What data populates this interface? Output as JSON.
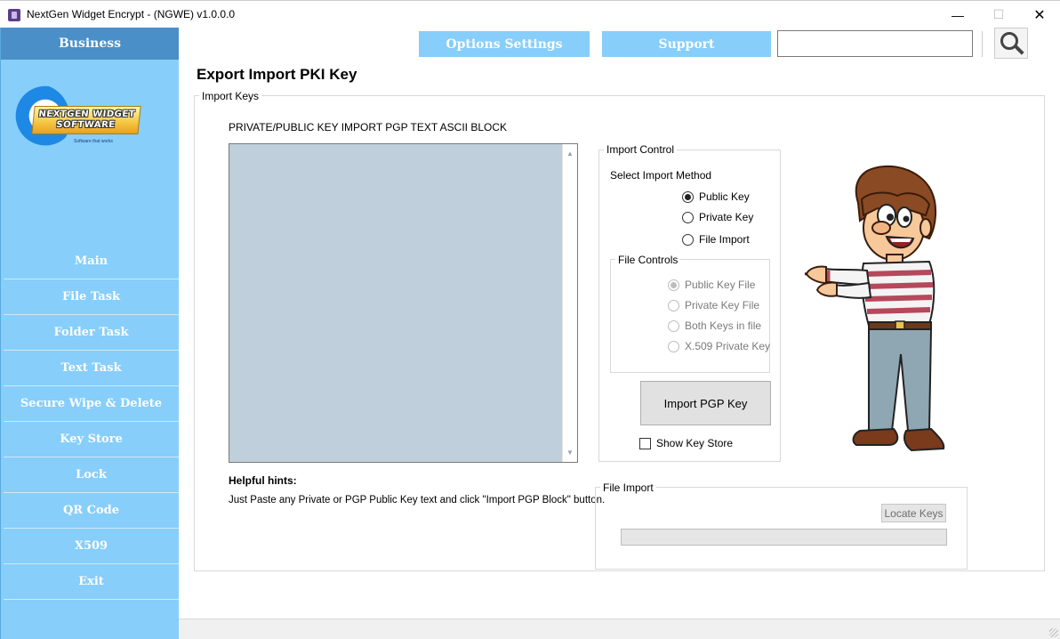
{
  "window": {
    "title": "NextGen Widget Encrypt - (NGWE) v1.0.0.0",
    "minimize": "—",
    "maximize": "☐",
    "close": "✕"
  },
  "sidebar": {
    "business": "Business",
    "logo": {
      "line1": "NEXTGEN WIDGET",
      "line2": "SOFTWARE",
      "tagline": "Software that works"
    },
    "items": [
      {
        "label": "Main"
      },
      {
        "label": "File Task"
      },
      {
        "label": "Folder Task"
      },
      {
        "label": "Text Task"
      },
      {
        "label": "Secure Wipe & Delete"
      },
      {
        "label": "Key Store"
      },
      {
        "label": "Lock"
      },
      {
        "label": "QR Code"
      },
      {
        "label": "X509"
      },
      {
        "label": "Exit"
      }
    ]
  },
  "topbar": {
    "options_label": "Options Settings",
    "support_label": "Support",
    "search_value": "",
    "search_icon": "magnifier-icon"
  },
  "page": {
    "title": "Export Import PKI Key",
    "import_keys_group": "Import Keys",
    "pgp_caption": "PRIVATE/PUBLIC KEY IMPORT PGP TEXT ASCII BLOCK",
    "pgp_text": "",
    "hints_title": "Helpful hints:",
    "hints_text": "Just Paste any Private or PGP Public Key text and click \"Import PGP Block\" button."
  },
  "import_control": {
    "group_label": "Import Control",
    "select_label": "Select Import Method",
    "methods": [
      {
        "label": "Public Key",
        "selected": true
      },
      {
        "label": "Private Key",
        "selected": false
      },
      {
        "label": "File Import",
        "selected": false
      }
    ],
    "file_controls_label": "File Controls",
    "file_options": [
      {
        "label": "Public Key File",
        "selected": true
      },
      {
        "label": "Private Key File",
        "selected": false
      },
      {
        "label": "Both Keys in file",
        "selected": false
      },
      {
        "label": "X.509 Private Key",
        "selected": false
      }
    ],
    "import_button": "Import PGP Key",
    "show_key_store": "Show Key Store",
    "show_key_store_checked": false
  },
  "file_import": {
    "group_label": "File Import",
    "locate_button": "Locate Keys",
    "progress": 0
  },
  "colors": {
    "sidebar_bg": "#87cefa",
    "sidebar_header": "#4a8fc7",
    "textarea_bg": "#bfcfdc"
  }
}
